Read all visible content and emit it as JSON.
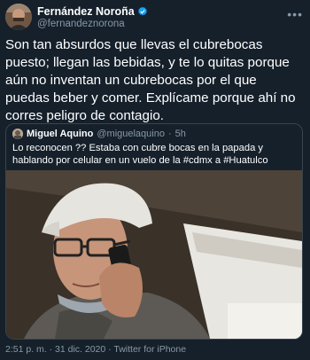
{
  "author": {
    "display_name": "Fernández Noroña",
    "handle": "@fernandeznorona",
    "more_icon": "ellipsis-icon"
  },
  "tweet_text": "Son tan absurdos que llevas el cubrebocas puesto; llegan las bebidas, y te lo quitas porque aún no inventan un cubrebocas por el que puedas beber y comer. Explícame porque ahí no corres peligro de contagio.",
  "quoted": {
    "display_name": "Miguel Aquino",
    "handle": "@miguelaquino",
    "time": "5h",
    "text": "Lo reconocen ?? Estaba con cubre bocas en la papada y hablando por celular en un vuelo de la #cdmx a #Huatulco"
  },
  "footer": {
    "meta": "2:51 p. m. · 31 dic. 2020 · Twitter for iPhone"
  },
  "colors": {
    "background": "#15202b",
    "secondary_text": "#8899a6",
    "border": "#38444d",
    "verified": "#1da1f2"
  }
}
